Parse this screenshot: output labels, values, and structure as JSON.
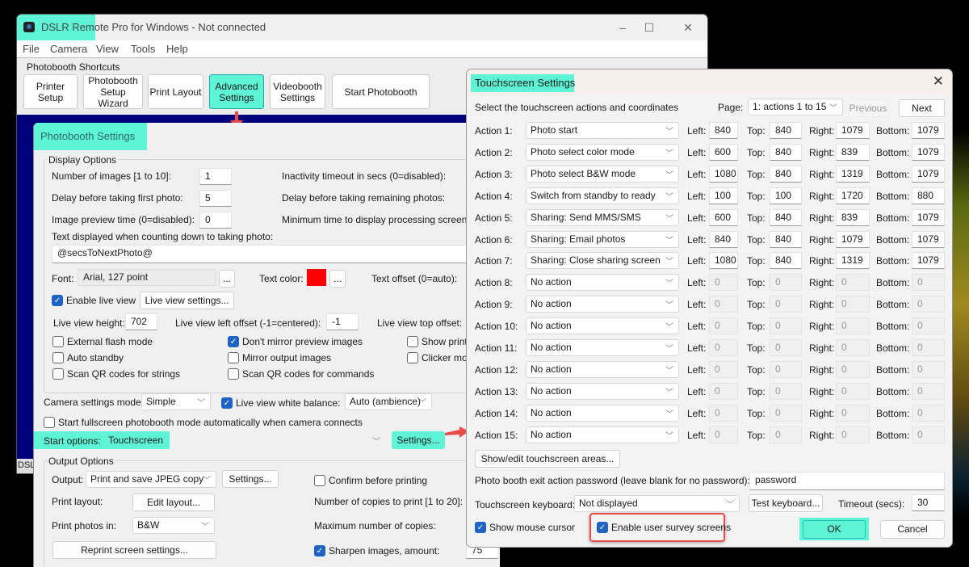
{
  "main_window": {
    "title": "DSLR Remote Pro for Windows - Not connected",
    "caption_buttons": {
      "minimize": "–",
      "maximize": "☐",
      "close": "✕"
    },
    "menu": [
      "File",
      "Camera",
      "View",
      "Tools",
      "Help"
    ],
    "shortcuts_label": "Photobooth Shortcuts",
    "shortcuts": [
      "Printer Setup",
      "Photobooth Setup Wizard",
      "Print Layout",
      "Advanced Settings",
      "Videobooth Settings",
      "Start Photobooth"
    ],
    "taskbar_stub": "DSL"
  },
  "photobooth_settings": {
    "title": "Photobooth Settings",
    "display_options": {
      "group_label": "Display Options",
      "num_images_label": "Number of images [1 to 10]:",
      "num_images": "1",
      "delay_first_label": "Delay before taking first photo:",
      "delay_first": "5",
      "preview_time_label": "Image preview time (0=disabled):",
      "preview_time": "0",
      "inactivity_label": "Inactivity timeout in secs (0=disabled):",
      "delay_remaining_label": "Delay before taking remaining photos:",
      "min_processing_label": "Minimum time to display processing screen:",
      "countdown_text_label": "Text displayed when counting down to taking photo:",
      "countdown_text": "@secsToNextPhoto@",
      "font_label": "Font:",
      "font_value": "Arial, 127 point",
      "ellipsis": "...",
      "text_color_label": "Text color:",
      "text_color": "#ff0000",
      "text_offset_label": "Text offset (0=auto):",
      "enable_live_view": "Enable live view",
      "live_view_settings": "Live view settings...",
      "live_view_height_label": "Live view height:",
      "live_view_height": "702",
      "live_view_left_label": "Live view left offset (-1=centered):",
      "live_view_left": "-1",
      "live_view_top_label": "Live view top offset:",
      "checkboxes": [
        {
          "label": "External flash mode",
          "checked": false
        },
        {
          "label": "Don't mirror preview images",
          "checked": true
        },
        {
          "label": "Show print",
          "checked": false
        },
        {
          "label": "Auto standby",
          "checked": false
        },
        {
          "label": "Mirror output images",
          "checked": false
        },
        {
          "label": "Clicker mod",
          "checked": false
        },
        {
          "label": "Scan QR codes for strings",
          "checked": false
        },
        {
          "label": "Scan QR codes for commands",
          "checked": false
        }
      ]
    },
    "camera_settings_mode_label": "Camera settings mode:",
    "camera_settings_mode": "Simple",
    "live_view_wb_label": "Live view white balance:",
    "live_view_wb": "Auto (ambience)",
    "start_fullscreen": "Start fullscreen photobooth mode automatically when camera connects",
    "start_options_label": "Start options:",
    "start_options": "Touchscreen",
    "settings_button": "Settings...",
    "output_options": {
      "group_label": "Output Options",
      "output_label": "Output:",
      "output_value": "Print and save JPEG copy",
      "settings_button": "Settings...",
      "confirm_printing": "Confirm before printing",
      "print_layout_label": "Print layout:",
      "edit_layout": "Edit layout...",
      "copies_label": "Number of copies to print [1 to 20]:",
      "print_photos_label": "Print photos in:",
      "print_photos_value": "B&W",
      "max_copies_label": "Maximum number of copies:",
      "reprint_settings": "Reprint screen settings...",
      "sharpen_label": "Sharpen images, amount:",
      "sharpen_value": "75"
    }
  },
  "touchscreen_settings": {
    "title": "Touchscreen Settings",
    "instructions": "Select the touchscreen actions and coordinates",
    "page_label": "Page:",
    "page_value": "1: actions 1 to 15",
    "previous": "Previous",
    "next": "Next",
    "coord_labels": {
      "left": "Left:",
      "top": "Top:",
      "right": "Right:",
      "bottom": "Bottom:"
    },
    "actions": [
      {
        "label": "Action 1:",
        "action": "Photo start",
        "left": "840",
        "top": "840",
        "right": "1079",
        "bottom": "1079",
        "enabled": true
      },
      {
        "label": "Action 2:",
        "action": "Photo select color mode",
        "left": "600",
        "top": "840",
        "right": "839",
        "bottom": "1079",
        "enabled": true
      },
      {
        "label": "Action 3:",
        "action": "Photo select B&W mode",
        "left": "1080",
        "top": "840",
        "right": "1319",
        "bottom": "1079",
        "enabled": true
      },
      {
        "label": "Action 4:",
        "action": "Switch from standby to ready",
        "left": "100",
        "top": "100",
        "right": "1720",
        "bottom": "880",
        "enabled": true
      },
      {
        "label": "Action 5:",
        "action": "Sharing: Send MMS/SMS",
        "left": "600",
        "top": "840",
        "right": "839",
        "bottom": "1079",
        "enabled": true
      },
      {
        "label": "Action 6:",
        "action": "Sharing: Email photos",
        "left": "840",
        "top": "840",
        "right": "1079",
        "bottom": "1079",
        "enabled": true
      },
      {
        "label": "Action 7:",
        "action": "Sharing: Close sharing screen",
        "left": "1080",
        "top": "840",
        "right": "1319",
        "bottom": "1079",
        "enabled": true
      },
      {
        "label": "Action 8:",
        "action": "No action",
        "left": "0",
        "top": "0",
        "right": "0",
        "bottom": "0",
        "enabled": false
      },
      {
        "label": "Action 9:",
        "action": "No action",
        "left": "0",
        "top": "0",
        "right": "0",
        "bottom": "0",
        "enabled": false
      },
      {
        "label": "Action 10:",
        "action": "No action",
        "left": "0",
        "top": "0",
        "right": "0",
        "bottom": "0",
        "enabled": false
      },
      {
        "label": "Action 11:",
        "action": "No action",
        "left": "0",
        "top": "0",
        "right": "0",
        "bottom": "0",
        "enabled": false
      },
      {
        "label": "Action 12:",
        "action": "No action",
        "left": "0",
        "top": "0",
        "right": "0",
        "bottom": "0",
        "enabled": false
      },
      {
        "label": "Action 13:",
        "action": "No action",
        "left": "0",
        "top": "0",
        "right": "0",
        "bottom": "0",
        "enabled": false
      },
      {
        "label": "Action 14:",
        "action": "No action",
        "left": "0",
        "top": "0",
        "right": "0",
        "bottom": "0",
        "enabled": false
      },
      {
        "label": "Action 15:",
        "action": "No action",
        "left": "0",
        "top": "0",
        "right": "0",
        "bottom": "0",
        "enabled": false
      }
    ],
    "show_edit_areas": "Show/edit touchscreen areas...",
    "password_label": "Photo booth exit action password (leave blank for no password):",
    "password": "password",
    "keyboard_label": "Touchscreen keyboard:",
    "keyboard_value": "Not displayed",
    "test_keyboard": "Test keyboard...",
    "timeout_label": "Timeout (secs):",
    "timeout": "30",
    "show_mouse_cursor": {
      "label": "Show mouse cursor",
      "checked": true
    },
    "enable_survey": {
      "label": "Enable user survey screens",
      "checked": true
    },
    "ok": "OK",
    "cancel": "Cancel",
    "close_icon": "✕"
  },
  "colors": {
    "highlight": "#5ef5d6",
    "annotation_red": "#e74c4c",
    "checkbox_blue": "#1f64c4",
    "blue_background": "#00007a"
  }
}
